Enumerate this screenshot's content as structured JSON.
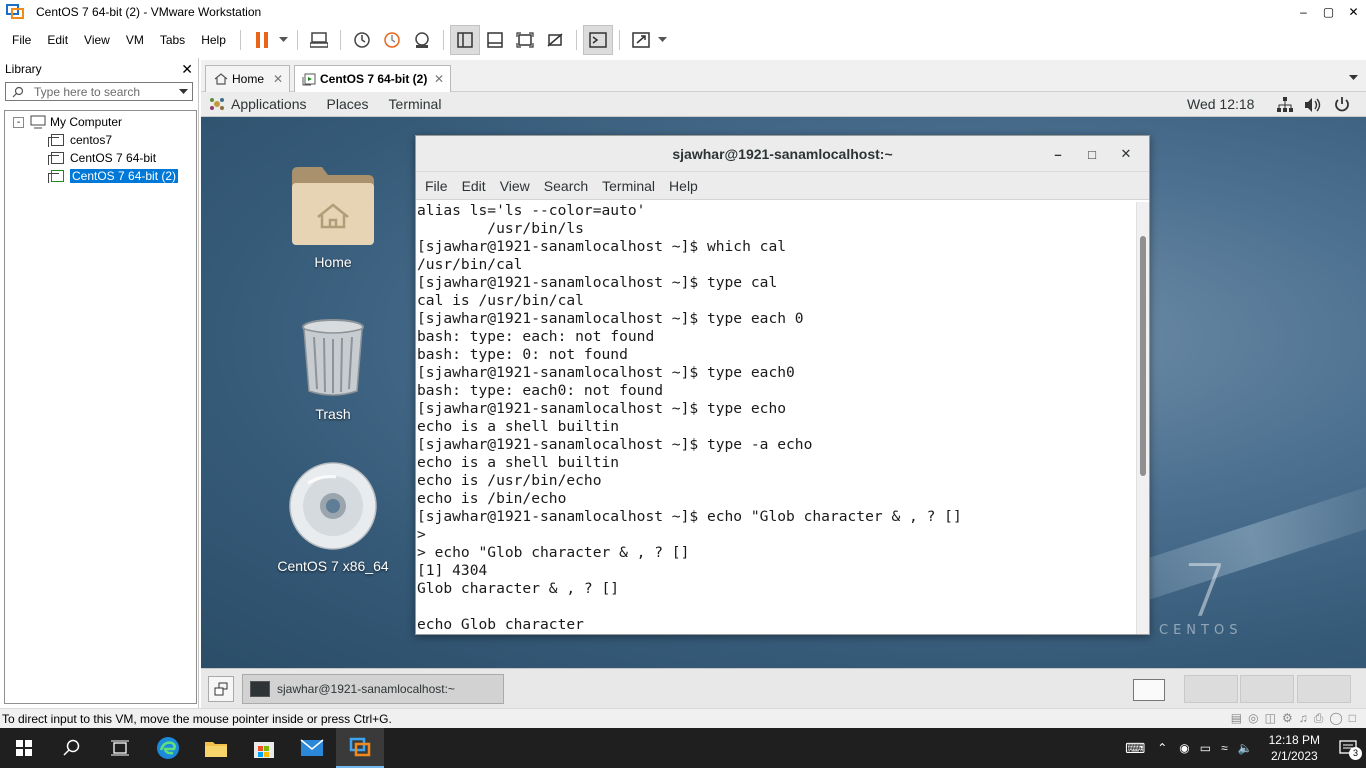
{
  "window": {
    "title": "CentOS 7 64-bit (2) - VMware Workstation"
  },
  "menubar": {
    "items": [
      "File",
      "Edit",
      "View",
      "VM",
      "Tabs",
      "Help"
    ]
  },
  "library": {
    "title": "Library",
    "search_placeholder": "Type here to search",
    "root": "My Computer",
    "vms": [
      "centos7",
      "CentOS 7 64-bit",
      "CentOS 7 64-bit (2)"
    ]
  },
  "tabs": [
    {
      "label": "Home"
    },
    {
      "label": "CentOS 7 64-bit (2)"
    }
  ],
  "gnome": {
    "topbar": {
      "applications": "Applications",
      "places": "Places",
      "terminal": "Terminal",
      "clock": "Wed 12:18"
    },
    "desktop_icons": [
      "Home",
      "Trash",
      "CentOS 7 x86_64"
    ],
    "logo": {
      "number": "7",
      "word": "CENTOS"
    },
    "taskbar_item": "sjawhar@1921-sanamlocalhost:~"
  },
  "terminal": {
    "title": "sjawhar@1921-sanamlocalhost:~",
    "menu": [
      "File",
      "Edit",
      "View",
      "Search",
      "Terminal",
      "Help"
    ],
    "lines": [
      "alias ls='ls --color=auto'",
      "        /usr/bin/ls",
      "[sjawhar@1921-sanamlocalhost ~]$ which cal",
      "/usr/bin/cal",
      "[sjawhar@1921-sanamlocalhost ~]$ type cal",
      "cal is /usr/bin/cal",
      "[sjawhar@1921-sanamlocalhost ~]$ type each 0",
      "bash: type: each: not found",
      "bash: type: 0: not found",
      "[sjawhar@1921-sanamlocalhost ~]$ type each0",
      "bash: type: each0: not found",
      "[sjawhar@1921-sanamlocalhost ~]$ type echo",
      "echo is a shell builtin",
      "[sjawhar@1921-sanamlocalhost ~]$ type -a echo",
      "echo is a shell builtin",
      "echo is /usr/bin/echo",
      "echo is /bin/echo",
      "[sjawhar@1921-sanamlocalhost ~]$ echo \"Glob character & , ? []",
      ">",
      "> echo \"Glob character & , ? []",
      "[1] 4304",
      "Glob character & , ? []",
      "",
      "echo Glob character"
    ]
  },
  "statusbar": {
    "text": "To direct input to this VM, move the mouse pointer inside or press Ctrl+G."
  },
  "win_taskbar": {
    "time": "12:18 PM",
    "date": "2/1/2023",
    "notifications": "3"
  },
  "colors": {
    "accent": "#0078d7",
    "vm_bg": "#3f6584",
    "pause": "#e8641b"
  }
}
